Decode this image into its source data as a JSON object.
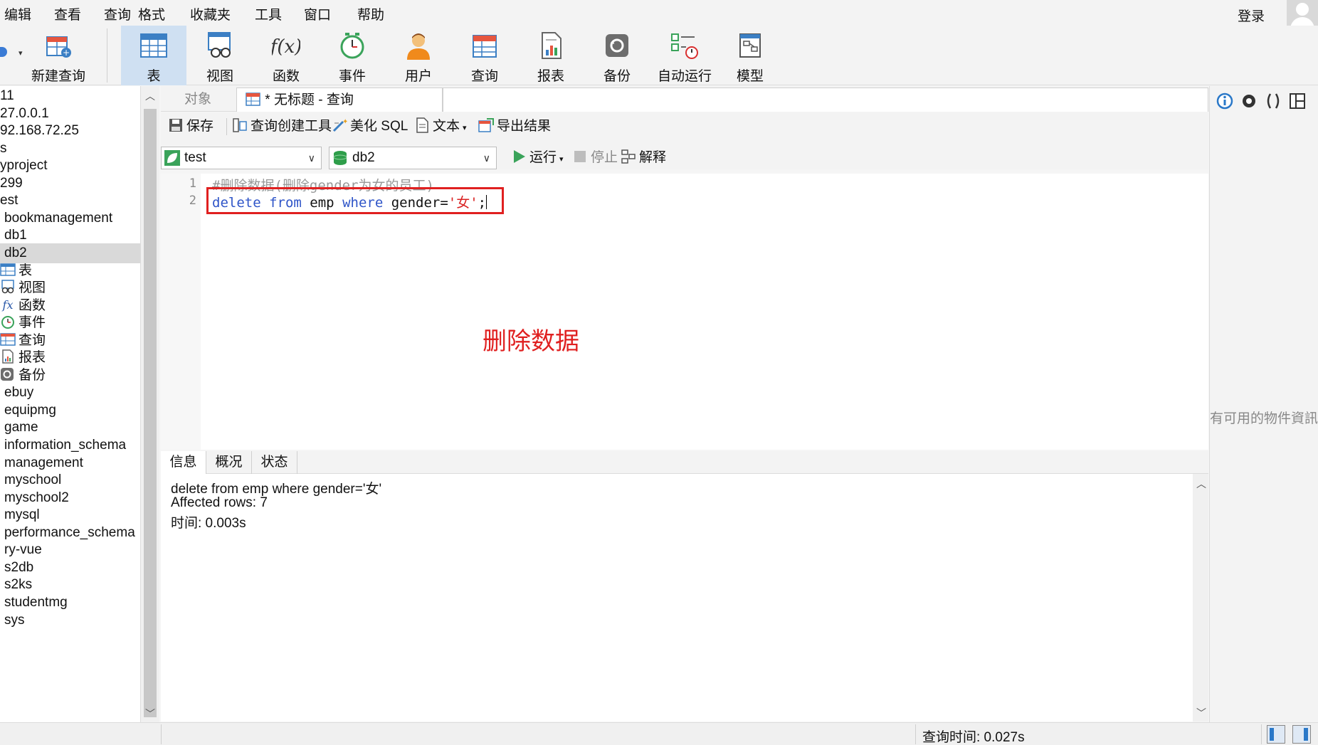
{
  "menu": {
    "items": [
      "编辑",
      "查看",
      "查询",
      "格式",
      "收藏夹",
      "工具",
      "窗口",
      "帮助"
    ],
    "login_label": "登录"
  },
  "toolbar": {
    "items": [
      {
        "label": "新建查询",
        "icon": "new-query-icon"
      },
      {
        "label": "表",
        "icon": "table-icon",
        "active": true
      },
      {
        "label": "视图",
        "icon": "view-icon"
      },
      {
        "label": "函数",
        "icon": "function-icon"
      },
      {
        "label": "事件",
        "icon": "event-clock-icon"
      },
      {
        "label": "用户",
        "icon": "user-icon"
      },
      {
        "label": "查询",
        "icon": "query-icon"
      },
      {
        "label": "报表",
        "icon": "report-icon"
      },
      {
        "label": "备份",
        "icon": "backup-icon"
      },
      {
        "label": "自动运行",
        "icon": "automation-icon"
      },
      {
        "label": "模型",
        "icon": "model-icon"
      }
    ]
  },
  "sidebar": {
    "items": [
      {
        "label": "11",
        "indent": 0
      },
      {
        "label": "27.0.0.1",
        "indent": 0
      },
      {
        "label": "92.168.72.25",
        "indent": 0
      },
      {
        "label": "s",
        "indent": 0
      },
      {
        "label": "yproject",
        "indent": 0
      },
      {
        "label": "299",
        "indent": 0
      },
      {
        "label": "est",
        "indent": 0
      },
      {
        "label": "bookmanagement",
        "indent": 1
      },
      {
        "label": "db1",
        "indent": 1
      },
      {
        "label": "db2",
        "indent": 1,
        "selected": true
      },
      {
        "label": "表",
        "indent": 2,
        "icon": "table-icon"
      },
      {
        "label": "视图",
        "indent": 2,
        "icon": "view-icon"
      },
      {
        "label": "函数",
        "indent": 2,
        "icon": "function-icon"
      },
      {
        "label": "事件",
        "indent": 2,
        "icon": "event-clock-icon"
      },
      {
        "label": "查询",
        "indent": 2,
        "icon": "query-icon"
      },
      {
        "label": "报表",
        "indent": 2,
        "icon": "report-icon"
      },
      {
        "label": "备份",
        "indent": 2,
        "icon": "backup-icon"
      },
      {
        "label": "ebuy",
        "indent": 1
      },
      {
        "label": "equipmg",
        "indent": 1
      },
      {
        "label": "game",
        "indent": 1
      },
      {
        "label": "information_schema",
        "indent": 1
      },
      {
        "label": "management",
        "indent": 1
      },
      {
        "label": "myschool",
        "indent": 1
      },
      {
        "label": "myschool2",
        "indent": 1
      },
      {
        "label": "mysql",
        "indent": 1
      },
      {
        "label": "performance_schema",
        "indent": 1
      },
      {
        "label": "ry-vue",
        "indent": 1
      },
      {
        "label": "s2db",
        "indent": 1
      },
      {
        "label": "s2ks",
        "indent": 1
      },
      {
        "label": "studentmg",
        "indent": 1
      },
      {
        "label": "sys",
        "indent": 1
      }
    ]
  },
  "tabs": {
    "objects_label": "对象",
    "query_label": "* 无标题 - 查询"
  },
  "query_toolbar": {
    "save": "保存",
    "builder": "查询创建工具",
    "beautify": "美化 SQL",
    "text": "文本",
    "export": "导出结果",
    "connection": "test",
    "database": "db2",
    "run": "运行",
    "stop": "停止",
    "explain": "解释"
  },
  "editor": {
    "line_numbers": [
      "1",
      "2"
    ],
    "line1_comment": "#删除数据(删除gender为女的员工)",
    "line2": {
      "kw1": "delete",
      "kw2": "from",
      "table": " emp ",
      "kw3": "where",
      "cond": " gender=",
      "value": "'女'",
      "end": ";"
    },
    "annotation": "删除数据",
    "annotation_color": "#e02020"
  },
  "results": {
    "tabs": [
      "信息",
      "概况",
      "状态"
    ],
    "lines": [
      "delete from emp where gender='女'",
      "Affected rows: 7",
      "时间: 0.003s"
    ]
  },
  "right_panel": {
    "message": "有可用的物件資訊"
  },
  "status": {
    "query_time": "查询时间: 0.027s"
  }
}
